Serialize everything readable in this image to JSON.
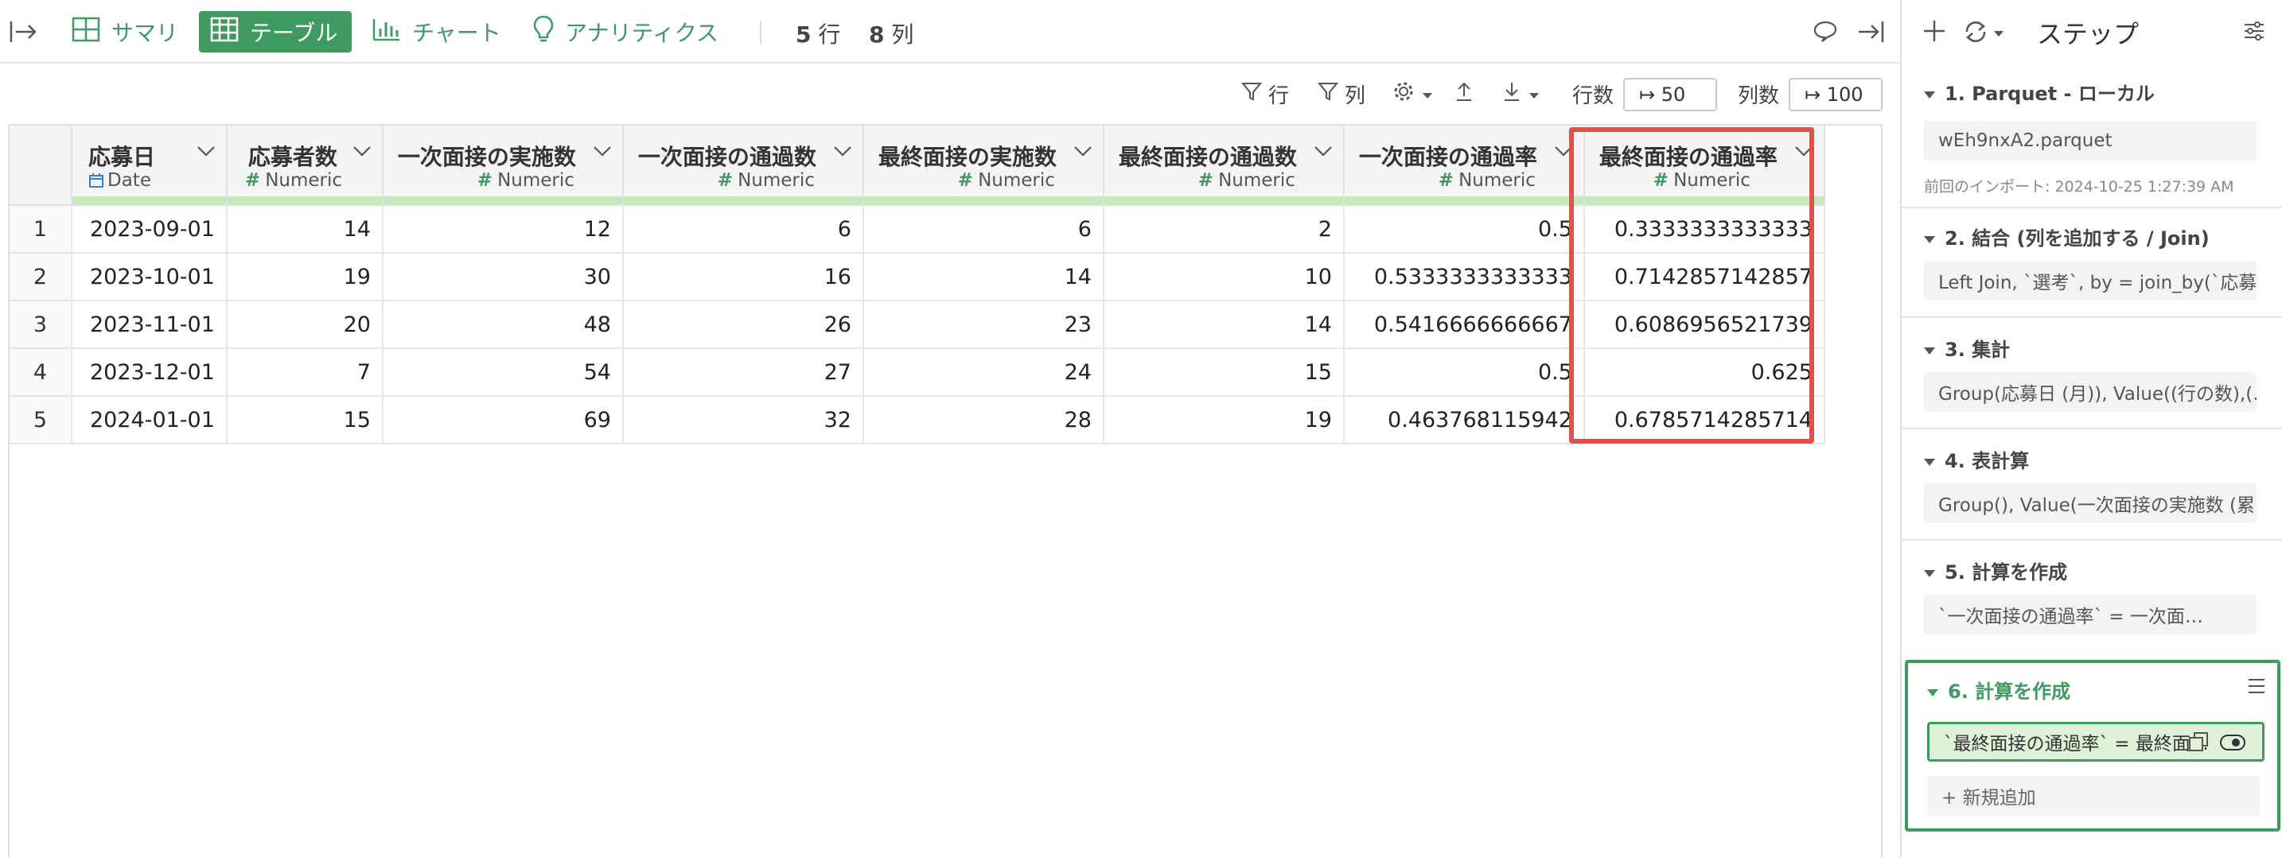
{
  "toolbar": {
    "tabs": [
      {
        "label": "サマリ",
        "icon": "summary-grid-icon"
      },
      {
        "label": "テーブル",
        "icon": "table-icon",
        "active": true
      },
      {
        "label": "チャート",
        "icon": "bar-chart-icon"
      },
      {
        "label": "アナリティクス",
        "icon": "lightbulb-icon"
      }
    ],
    "row_count": "5",
    "row_unit": "行",
    "col_count": "8",
    "col_unit": "列"
  },
  "subtoolbar": {
    "filter_rows": "行",
    "filter_cols": "列",
    "rows_label": "行数",
    "rows_value": "↦ 50",
    "cols_label": "列数",
    "cols_value": "↦ 100"
  },
  "table": {
    "columns": [
      {
        "name": "応募日",
        "type": "Date"
      },
      {
        "name": "応募者数",
        "type": "Numeric"
      },
      {
        "name": "一次面接の実施数",
        "type": "Numeric"
      },
      {
        "name": "一次面接の通過数",
        "type": "Numeric"
      },
      {
        "name": "最終面接の実施数",
        "type": "Numeric"
      },
      {
        "name": "最終面接の通過数",
        "type": "Numeric"
      },
      {
        "name": "一次面接の通過率",
        "type": "Numeric"
      },
      {
        "name": "最終面接の通過率",
        "type": "Numeric"
      }
    ],
    "rows": [
      {
        "n": "1",
        "c": [
          "2023-09-01",
          "14",
          "12",
          "6",
          "6",
          "2",
          "0.5",
          "0.3333333333333"
        ]
      },
      {
        "n": "2",
        "c": [
          "2023-10-01",
          "19",
          "30",
          "16",
          "14",
          "10",
          "0.5333333333333",
          "0.7142857142857"
        ]
      },
      {
        "n": "3",
        "c": [
          "2023-11-01",
          "20",
          "48",
          "26",
          "23",
          "14",
          "0.5416666666667",
          "0.6086956521739"
        ]
      },
      {
        "n": "4",
        "c": [
          "2023-12-01",
          "7",
          "54",
          "27",
          "24",
          "15",
          "0.5",
          "0.625"
        ]
      },
      {
        "n": "5",
        "c": [
          "2024-01-01",
          "15",
          "69",
          "32",
          "28",
          "19",
          "0.463768115942",
          "0.6785714285714"
        ]
      }
    ]
  },
  "panel": {
    "title": "ステップ",
    "steps": [
      {
        "title": "1. Parquet - ローカル",
        "detail": "wEh9nxA2.parquet",
        "meta": "前回のインポート: 2024-10-25 1:27:39 AM"
      },
      {
        "title": "2. 結合 (列を追加する / Join)",
        "detail": "Left Join, `選考`, by = join_by(`応募…"
      },
      {
        "title": "3. 集計",
        "detail": "Group(応募日 (月)), Value((行の数),(…"
      },
      {
        "title": "4. 表計算",
        "detail": "Group(), Value(一次面接の実施数 (累…"
      },
      {
        "title": "5. 計算を作成",
        "detail": "`一次面接の通過率` = 一次面…"
      },
      {
        "title": "6. 計算を作成",
        "detail": "`最終面接の通過率` = 最終面…",
        "add_label": "+ 新規追加"
      }
    ]
  },
  "colors": {
    "accent": "#3e9a61",
    "highlight": "#d9534f",
    "header_bar": "#c4eab7"
  }
}
